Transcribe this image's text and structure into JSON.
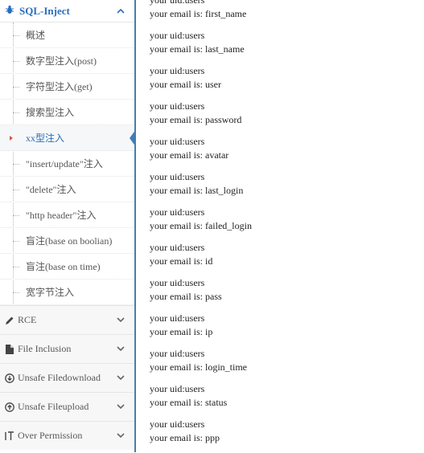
{
  "sidebar": {
    "section": {
      "label": "SQL-Inject",
      "icon": "bug-icon"
    },
    "subitems": [
      {
        "label": "概述"
      },
      {
        "label": "数字型注入(post)"
      },
      {
        "label": "字符型注入(get)"
      },
      {
        "label": "搜索型注入"
      },
      {
        "label": "xx型注入",
        "active": true
      },
      {
        "label": "\"insert/update\"注入"
      },
      {
        "label": "\"delete\"注入"
      },
      {
        "label": "\"http header\"注入"
      },
      {
        "label": "盲注(base on boolian)"
      },
      {
        "label": "盲注(base on time)"
      },
      {
        "label": "宽字节注入"
      }
    ],
    "groups": [
      {
        "label": "RCE",
        "icon": "pencil-icon"
      },
      {
        "label": "File Inclusion",
        "icon": "file-icon"
      },
      {
        "label": "Unsafe Filedownload",
        "icon": "download-icon"
      },
      {
        "label": "Unsafe Fileupload",
        "icon": "upload-icon"
      },
      {
        "label": "Over Permission",
        "icon": "text-cursor-icon"
      }
    ]
  },
  "results": [
    {
      "uid": "your uid:users",
      "email": "your email is: first_name"
    },
    {
      "uid": "your uid:users",
      "email": "your email is: last_name"
    },
    {
      "uid": "your uid:users",
      "email": "your email is: user"
    },
    {
      "uid": "your uid:users",
      "email": "your email is: password"
    },
    {
      "uid": "your uid:users",
      "email": "your email is: avatar"
    },
    {
      "uid": "your uid:users",
      "email": "your email is: last_login"
    },
    {
      "uid": "your uid:users",
      "email": "your email is: failed_login"
    },
    {
      "uid": "your uid:users",
      "email": "your email is: id"
    },
    {
      "uid": "your uid:users",
      "email": "your email is: pass"
    },
    {
      "uid": "your uid:users",
      "email": "your email is: ip"
    },
    {
      "uid": "your uid:users",
      "email": "your email is: login_time"
    },
    {
      "uid": "your uid:users",
      "email": "your email is: status"
    },
    {
      "uid": "your uid:users",
      "email": "your email is: ppp"
    }
  ],
  "colors": {
    "accent": "#2a6ebb",
    "sidebar_border": "#3f7fb8",
    "active_bullet": "#d15b47"
  }
}
